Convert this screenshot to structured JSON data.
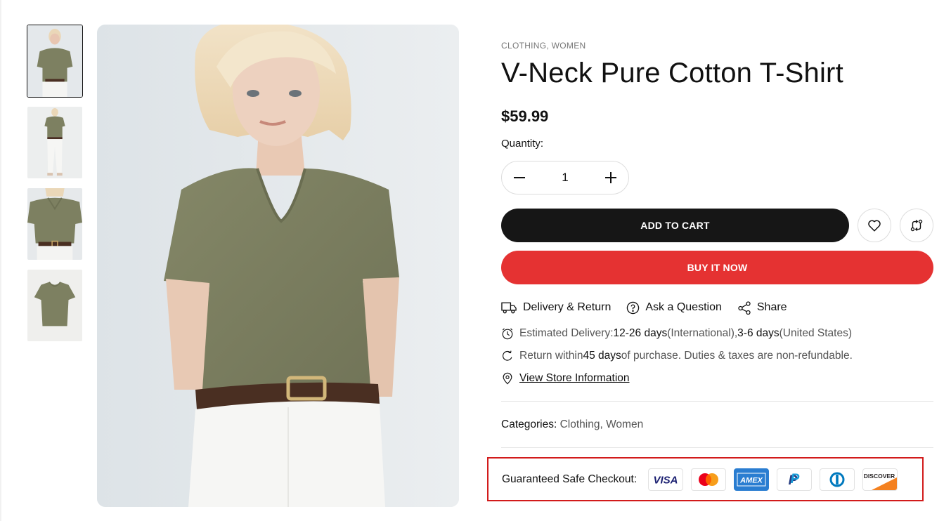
{
  "gallery": {
    "thumbnails": [
      {
        "label": "Front view on model",
        "active": true
      },
      {
        "label": "Full body view"
      },
      {
        "label": "Close-up of waist"
      },
      {
        "label": "Flat lay"
      }
    ]
  },
  "product": {
    "categories_top": "CLOTHING, WOMEN",
    "title": "V-Neck Pure Cotton T-Shirt",
    "price": "$59.99",
    "quantity_label": "Quantity:",
    "quantity_value": "1",
    "add_to_cart": "ADD TO CART",
    "buy_now": "BUY IT NOW"
  },
  "links": {
    "delivery_return": "Delivery & Return",
    "ask_question": "Ask a Question",
    "share": "Share"
  },
  "delivery": {
    "estimated_prefix": "Estimated Delivery: ",
    "international_days": "12-26 days",
    "international_label": " (International), ",
    "us_days": "3-6 days",
    "us_label": " (United States)",
    "return_prefix": "Return within ",
    "return_days": "45 days",
    "return_suffix": " of purchase. Duties & taxes are non-refundable.",
    "store_info": "View Store Information"
  },
  "categories": {
    "label": "Categories: ",
    "items": [
      "Clothing",
      "Women"
    ],
    "separator": ", "
  },
  "checkout": {
    "label": "Guaranteed Safe Checkout:",
    "payment_methods": [
      {
        "name": "visa-icon",
        "text": "VISA"
      },
      {
        "name": "mastercard-icon"
      },
      {
        "name": "amex-icon",
        "text": "AMEX"
      },
      {
        "name": "paypal-icon",
        "text": "P"
      },
      {
        "name": "diners-club-icon"
      },
      {
        "name": "discover-icon",
        "text": "DISCOVER"
      }
    ]
  },
  "colors": {
    "primary_button": "#161616",
    "buy_now": "#e53232",
    "highlight_box": "#d21b1b"
  }
}
